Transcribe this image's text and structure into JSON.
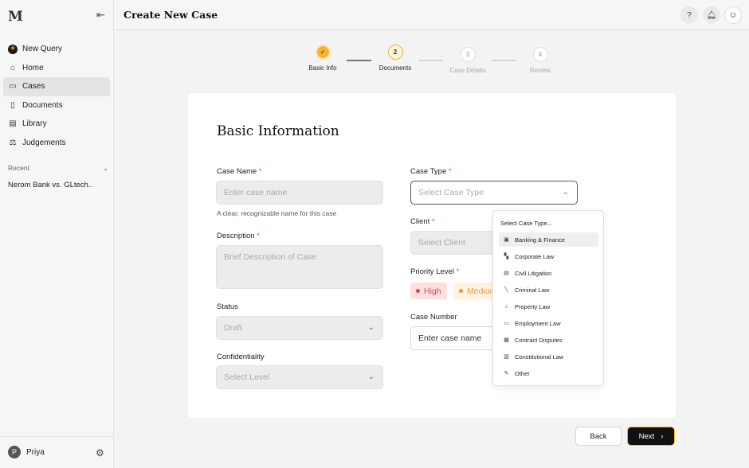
{
  "app": {
    "logo": "M"
  },
  "sidebar": {
    "items": [
      {
        "label": "New Query",
        "icon": "plus-circle-icon"
      },
      {
        "label": "Home",
        "icon": "home-icon"
      },
      {
        "label": "Cases",
        "icon": "briefcase-icon",
        "active": true
      },
      {
        "label": "Documents",
        "icon": "document-icon"
      },
      {
        "label": "Library",
        "icon": "library-icon"
      },
      {
        "label": "Judgements",
        "icon": "scales-icon"
      }
    ],
    "recent_heading": "Recent",
    "recent_items": [
      "Nerom Bank vs. GLtech.."
    ],
    "user": {
      "initial": "P",
      "name": "Priya"
    }
  },
  "header": {
    "title": "Create New Case",
    "help": "?"
  },
  "stepper": {
    "steps": [
      {
        "number": "1",
        "label": "Basic Info",
        "state": "done"
      },
      {
        "number": "2",
        "label": "Documents",
        "state": "current"
      },
      {
        "number": "3",
        "label": "Case Details",
        "state": "future"
      },
      {
        "number": "4",
        "label": "Review",
        "state": "future"
      }
    ]
  },
  "form": {
    "title": "Basic Information",
    "case_name": {
      "label": "Case Name",
      "required": "*",
      "placeholder": "Enter case name",
      "hint": "A clear, recognizable name for this case"
    },
    "description": {
      "label": "Description",
      "required": "*",
      "placeholder": "Brief Description of Case"
    },
    "status": {
      "label": "Status",
      "value": "Draft"
    },
    "confidentiality": {
      "label": "Confidentiality",
      "placeholder": "Select Level"
    },
    "case_type": {
      "label": "Case Type",
      "required": "*",
      "placeholder": "Select Case Type"
    },
    "client": {
      "label": "Client",
      "required": "*",
      "placeholder": "Select Client"
    },
    "priority": {
      "label": "Priority Level",
      "required": "*",
      "options": [
        "High",
        "Medium"
      ]
    },
    "case_number": {
      "label": "Case Number",
      "placeholder": "Enter case name"
    }
  },
  "case_type_dropdown": {
    "heading": "Select Case Type...",
    "options": [
      {
        "label": "Banking & Finance",
        "icon": "bank-icon"
      },
      {
        "label": "Corporate Law",
        "icon": "building-icon"
      },
      {
        "label": "Civil Litigation",
        "icon": "document-icon"
      },
      {
        "label": "Criminal Law",
        "icon": "gavel-icon"
      },
      {
        "label": "Property Law",
        "icon": "house-icon"
      },
      {
        "label": "Employment Law",
        "icon": "laptop-icon"
      },
      {
        "label": "Contract Disputes",
        "icon": "contract-icon"
      },
      {
        "label": "Constitutional Law",
        "icon": "book-icon"
      },
      {
        "label": "Other",
        "icon": "edit-icon"
      }
    ]
  },
  "actions": {
    "back": "Back",
    "next": "Next"
  },
  "colors": {
    "accent": "#f5b32f",
    "high": "#e04545",
    "medium": "#f09a2c"
  }
}
